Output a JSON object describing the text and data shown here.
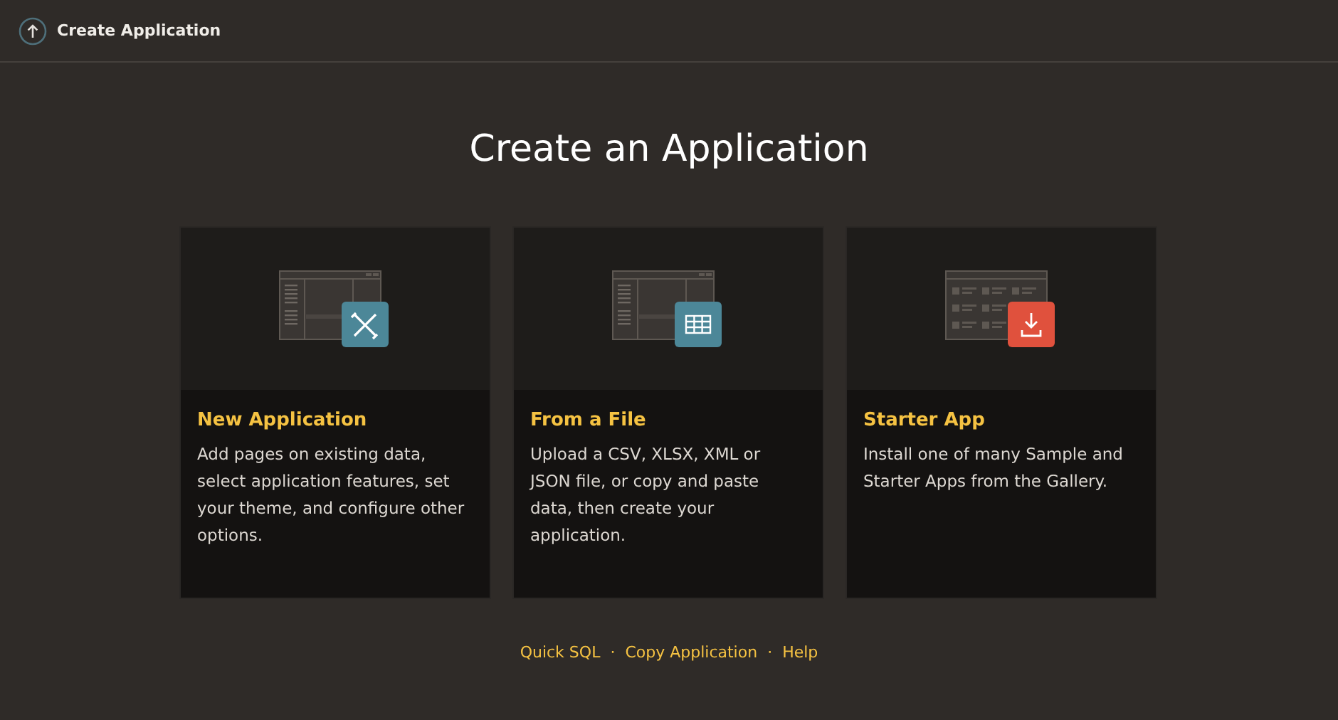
{
  "header": {
    "title": "Create Application"
  },
  "heading": "Create an Application",
  "cards": [
    {
      "kind": "design",
      "title": "New Application",
      "description": "Add pages on existing data, select application features, set your theme, and configure other options."
    },
    {
      "kind": "table",
      "title": "From a File",
      "description": "Upload a CSV, XLSX, XML or JSON file, or copy and paste data, then create your application."
    },
    {
      "kind": "gallery",
      "title": "Starter App",
      "description": "Install one of many Sample and Starter Apps from the Gallery."
    }
  ],
  "footer": {
    "separator": "·",
    "links": [
      "Quick SQL",
      "Copy Application",
      "Help"
    ]
  }
}
